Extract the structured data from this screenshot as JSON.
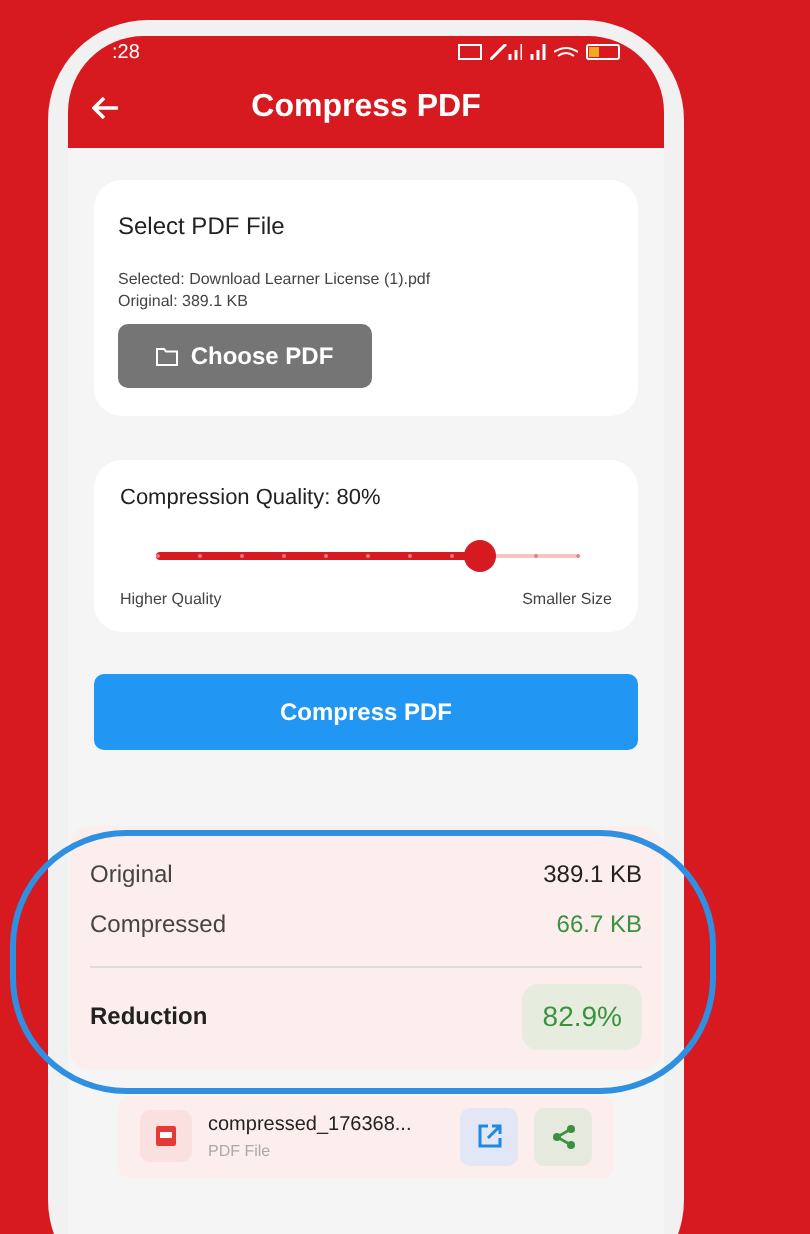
{
  "status_bar": {
    "time": ":28"
  },
  "app_bar": {
    "title": "Compress PDF"
  },
  "file_card": {
    "title": "Select PDF File",
    "selected": "Selected: Download Learner License (1).pdf",
    "original": "Original: 389.1 KB",
    "button": "Choose PDF"
  },
  "quality_card": {
    "label": "Compression Quality: 80%",
    "level": 0.77,
    "min_label": "Higher Quality",
    "max_label": "Smaller Size"
  },
  "compress_button": "Compress PDF",
  "results": {
    "rows": [
      {
        "label": "Original",
        "value": "389.1 KB",
        "kind": "plain"
      },
      {
        "label": "Compressed",
        "value": "66.7 KB",
        "kind": "good"
      }
    ],
    "reduction_label": "Reduction",
    "reduction_value": "82.9%"
  },
  "output_file": {
    "name": "compressed_176368...",
    "type": "PDF File"
  }
}
